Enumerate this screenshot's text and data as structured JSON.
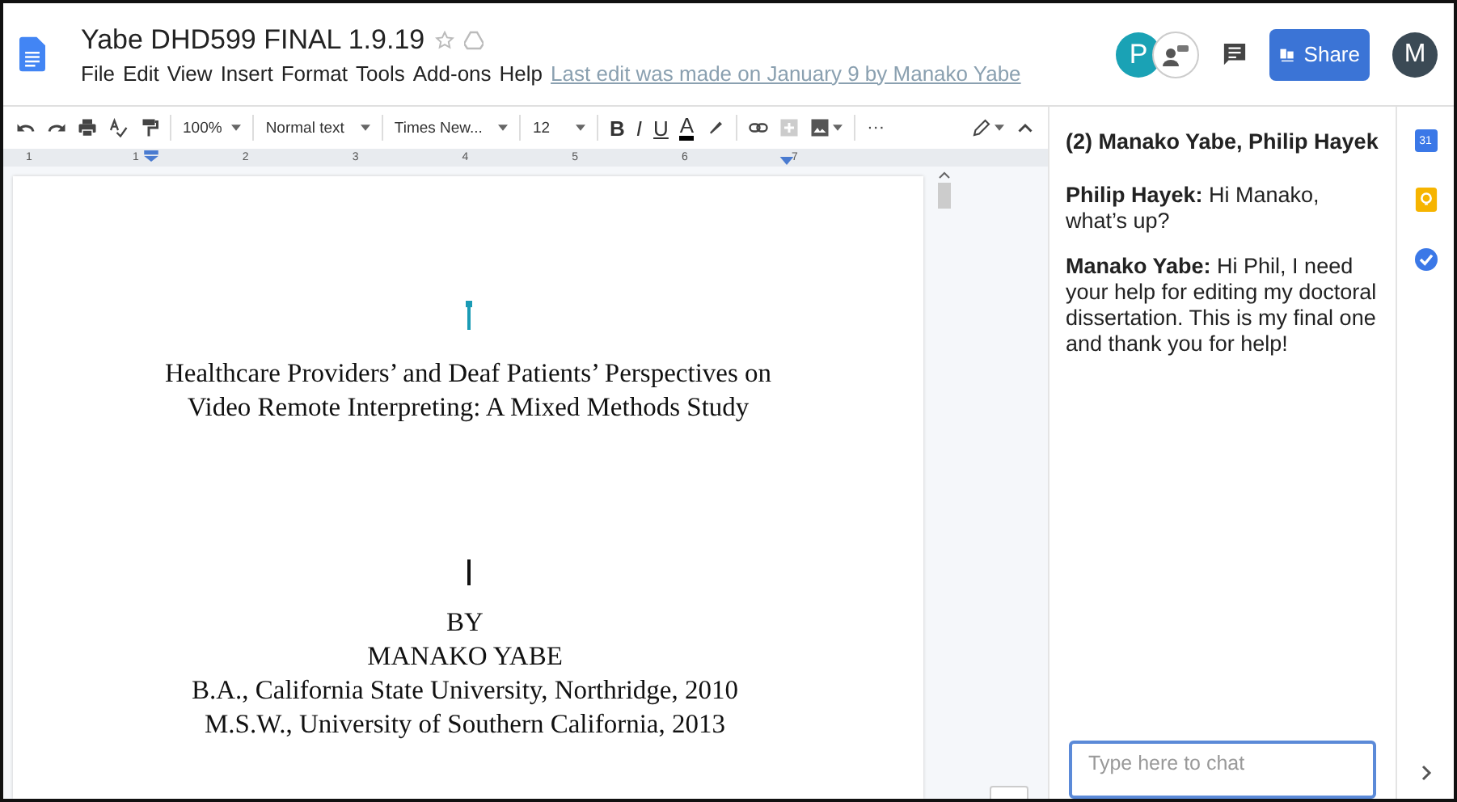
{
  "document": {
    "title": "Yabe DHD599 FINAL 1.9.19",
    "menu": [
      "File",
      "Edit",
      "View",
      "Insert",
      "Format",
      "Tools",
      "Add-ons",
      "Help"
    ],
    "last_edit": "Last edit was made on January 9 by Manako Yabe"
  },
  "header": {
    "collaborator_initial": "P",
    "share_label": "Share",
    "account_initial": "M"
  },
  "toolbar": {
    "zoom": "100%",
    "style": "Normal text",
    "font": "Times New...",
    "size": "12",
    "format_buttons": [
      "B",
      "I",
      "U",
      "A"
    ],
    "more": "···"
  },
  "ruler": [
    "1",
    "1",
    "2",
    "3",
    "4",
    "5",
    "6",
    "7"
  ],
  "page": {
    "title_lines": [
      "Healthcare Providers’ and Deaf Patients’ Perspectives on",
      "Video Remote Interpreting: A Mixed Methods Study"
    ],
    "author_lines": [
      "BY",
      "MANAKO YABE",
      "B.A., California State University, Northridge, 2010",
      "M.S.W., University of Southern California, 2013"
    ]
  },
  "chat": {
    "title": "(2) Manako Yabe, Philip Hayek",
    "messages": [
      {
        "sender": "Philip Hayek:",
        "text": "Hi Manako, what’s up?"
      },
      {
        "sender": "Manako Yabe:",
        "text": "Hi Phil, I need your help for editing my doctoral dissertation. This is my final one and thank you for help!"
      }
    ],
    "input": {
      "placeholder": "Type here to chat"
    }
  },
  "side_rail": {
    "calendar_day": "31"
  }
}
